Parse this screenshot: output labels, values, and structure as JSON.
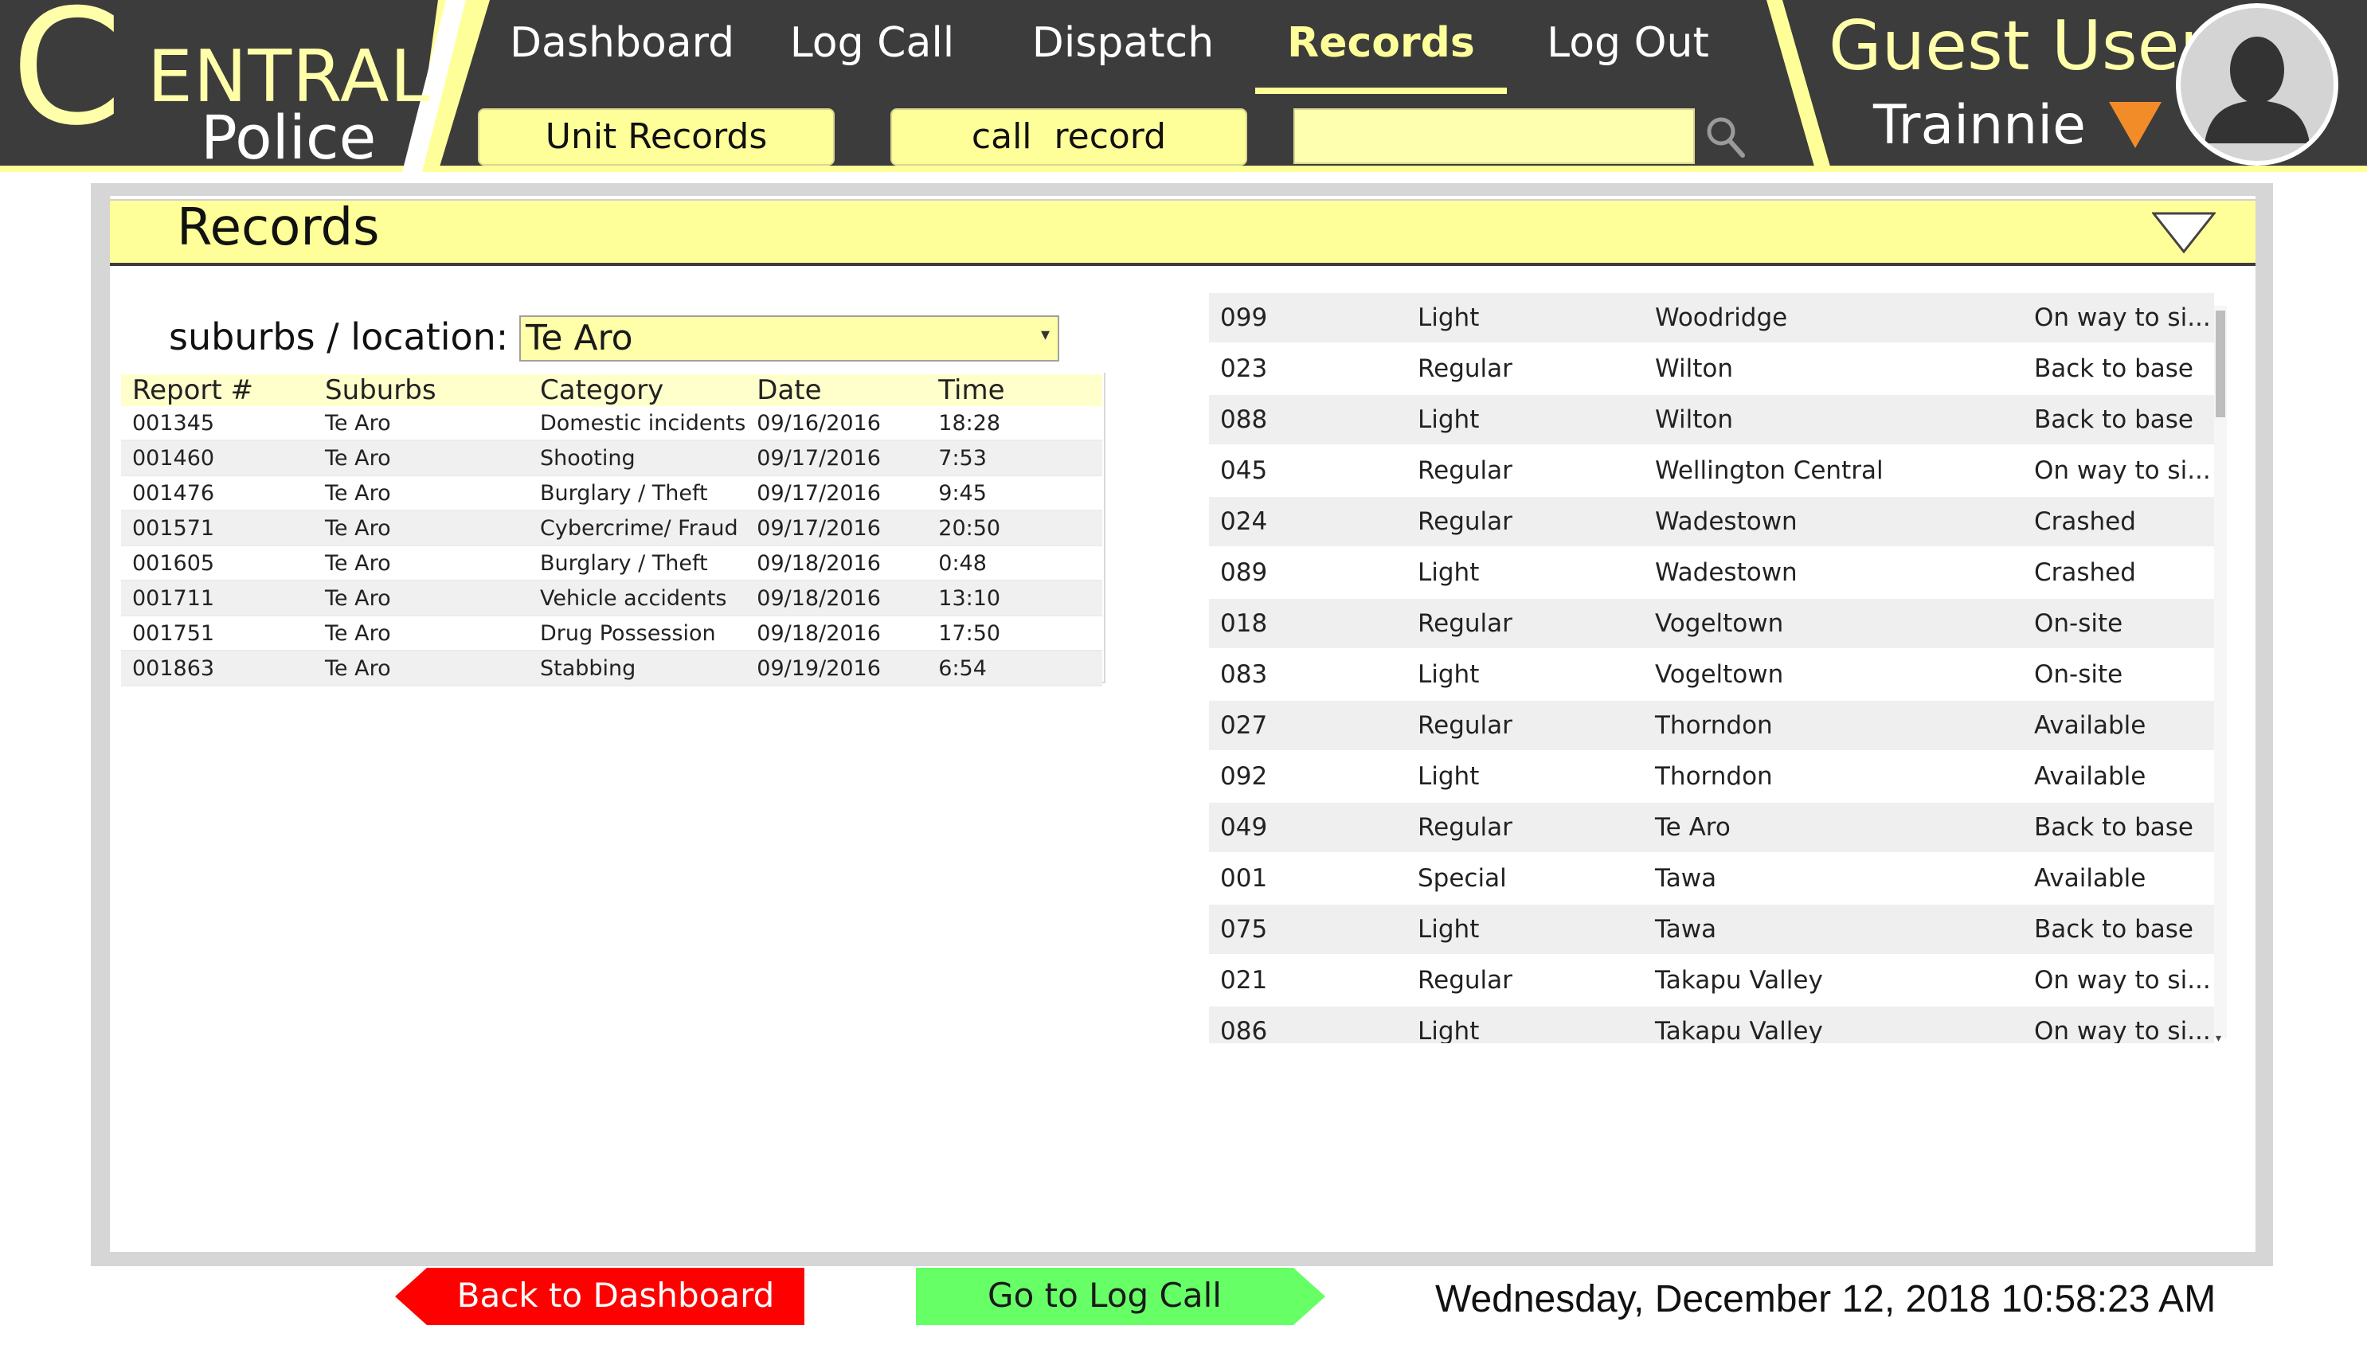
{
  "brand": {
    "initial": "C",
    "name_rest": "ENTRAL",
    "subtitle": "Police"
  },
  "nav": {
    "items": [
      {
        "label": "Dashboard"
      },
      {
        "label": "Log Call"
      },
      {
        "label": "Dispatch"
      },
      {
        "label": "Records",
        "active": true
      },
      {
        "label": "Log Out"
      }
    ]
  },
  "subnav": {
    "unit_records": "Unit Records",
    "call_record": "call  record",
    "search_value": ""
  },
  "user": {
    "name": "Guest User",
    "role": "Trainnie"
  },
  "panel": {
    "title": "Records",
    "suburb_label": "suburbs / location:",
    "suburb_value": "Te Aro"
  },
  "reports": {
    "headers": [
      "Report #",
      "Suburbs",
      "Category",
      "Date",
      "Time"
    ],
    "rows": [
      [
        "001345",
        "Te Aro",
        "Domestic incidents",
        "09/16/2016",
        "18:28"
      ],
      [
        "001460",
        "Te Aro",
        "Shooting",
        "09/17/2016",
        "7:53"
      ],
      [
        "001476",
        "Te Aro",
        "Burglary / Theft",
        "09/17/2016",
        "9:45"
      ],
      [
        "001571",
        "Te Aro",
        "Cybercrime/ Fraud",
        "09/17/2016",
        "20:50"
      ],
      [
        "001605",
        "Te Aro",
        "Burglary / Theft",
        "09/18/2016",
        "0:48"
      ],
      [
        "001711",
        "Te Aro",
        "Vehicle accidents",
        "09/18/2016",
        "13:10"
      ],
      [
        "001751",
        "Te Aro",
        "Drug Possession",
        "09/18/2016",
        "17:50"
      ],
      [
        "001863",
        "Te Aro",
        "Stabbing",
        "09/19/2016",
        "6:54"
      ]
    ]
  },
  "units": {
    "rows": [
      [
        "099",
        "Light",
        "Woodridge",
        "On way to si..."
      ],
      [
        "023",
        "Regular",
        "Wilton",
        "Back to base"
      ],
      [
        "088",
        "Light",
        "Wilton",
        "Back to base"
      ],
      [
        "045",
        "Regular",
        "Wellington Central",
        "On way to si..."
      ],
      [
        "024",
        "Regular",
        "Wadestown",
        "Crashed"
      ],
      [
        "089",
        "Light",
        "Wadestown",
        "Crashed"
      ],
      [
        "018",
        "Regular",
        "Vogeltown",
        "On-site"
      ],
      [
        "083",
        "Light",
        "Vogeltown",
        "On-site"
      ],
      [
        "027",
        "Regular",
        "Thorndon",
        "Available"
      ],
      [
        "092",
        "Light",
        "Thorndon",
        "Available"
      ],
      [
        "049",
        "Regular",
        "Te Aro",
        "Back to base"
      ],
      [
        "001",
        "Special",
        "Tawa",
        "Available"
      ],
      [
        "075",
        "Light",
        "Tawa",
        "Back to base"
      ],
      [
        "021",
        "Regular",
        "Takapu Valley",
        "On way to si..."
      ],
      [
        "086",
        "Light",
        "Takapu Valley",
        "On way to si..."
      ]
    ]
  },
  "footer": {
    "back_label": "Back to Dashboard",
    "log_call_label": "Go to Log Call",
    "datetime": "Wednesday, December 12, 2018 10:58:23 AM"
  },
  "colors": {
    "header_dark": "#3c3c3c",
    "accent_yellow": "#ffff99",
    "back_red": "#ff0000",
    "go_green": "#66ff66",
    "user_arrow": "#f28c28"
  },
  "icons": {
    "search": "search-icon",
    "dropdown": "caret-down-icon",
    "avatar": "user-silhouette-icon",
    "collapse": "triangle-down-icon"
  }
}
